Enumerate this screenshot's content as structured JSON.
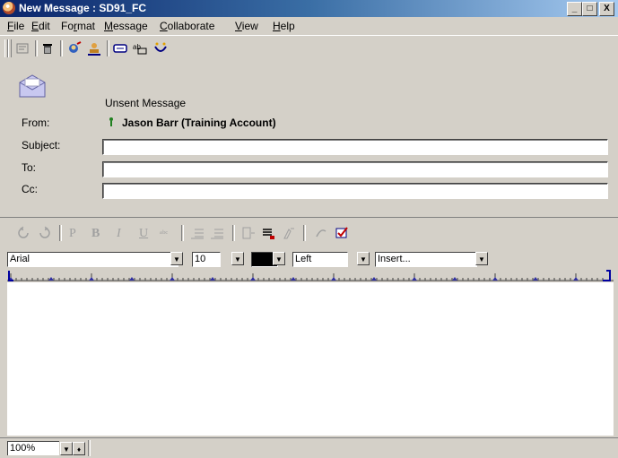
{
  "window": {
    "title": "New Message : SD91_FC",
    "controls": {
      "minimize": "_",
      "maximize": "□",
      "close": "X"
    }
  },
  "menu": {
    "items": [
      {
        "label": "File",
        "accel": "F",
        "rest": "ile"
      },
      {
        "label": "Edit",
        "accel": "E",
        "rest": "dit"
      },
      {
        "label": "Format",
        "pre": "Fo",
        "accel": "r",
        "rest": "mat"
      },
      {
        "label": "Message",
        "accel": "M",
        "rest": "essage"
      },
      {
        "label": "Collaborate",
        "accel": "C",
        "rest": "ollaborate"
      },
      {
        "label": "View",
        "accel": "V",
        "rest": "iew"
      },
      {
        "label": "Help",
        "accel": "H",
        "rest": "elp"
      }
    ]
  },
  "toolbar": {
    "icons": [
      "send-options-icon",
      "delete-icon",
      "address-book-icon",
      "user-icon",
      "spell-check-icon",
      "attach-icon",
      "insert-icon"
    ]
  },
  "header": {
    "status": "Unsent Message",
    "from_label": "From:",
    "from_value": "Jason Barr (Training Account)",
    "subject_label": "Subject:",
    "to_label": "To:",
    "cc_label": "Cc:",
    "subject_value": "",
    "to_value": "",
    "cc_value": ""
  },
  "format": {
    "buttons": {
      "bold": "B",
      "italic": "I",
      "underline": "U",
      "strike": "ᵃᵇᶜ",
      "plain": "P"
    },
    "font": "Arial",
    "size": "10",
    "color": "#000000",
    "align": "Left",
    "insert": "Insert..."
  },
  "status": {
    "zoom": "100%"
  }
}
